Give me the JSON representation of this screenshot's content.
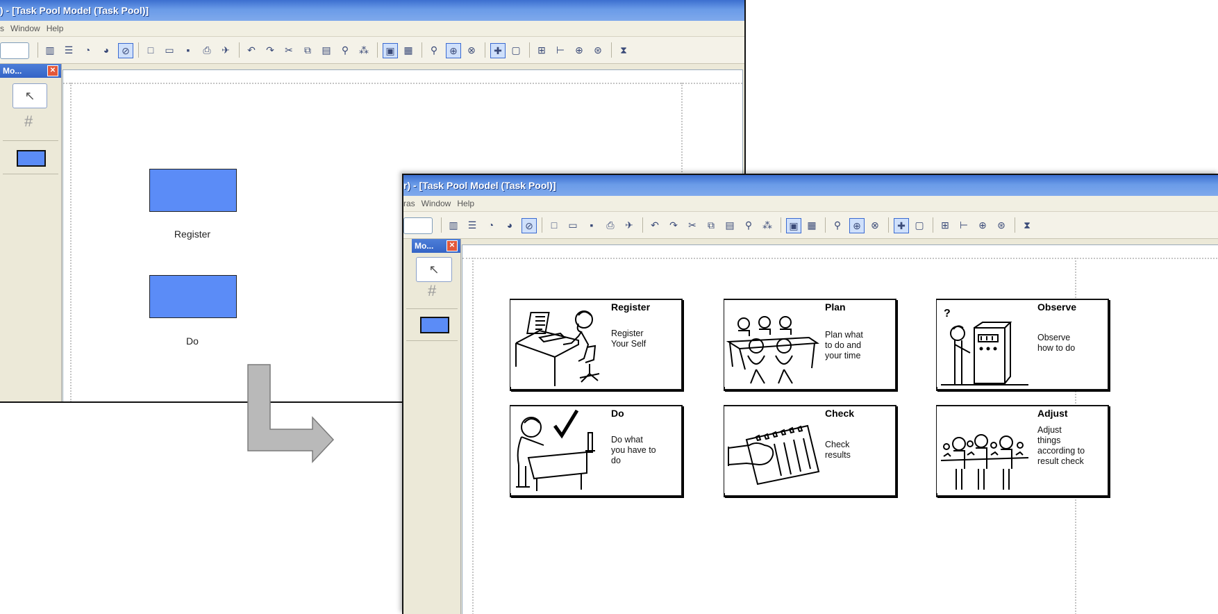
{
  "window1": {
    "title": ") - [Task Pool Model (Task Pool)]",
    "menu": [
      "s",
      "Window",
      "Help"
    ],
    "palette": {
      "header": "Mo...",
      "close": "✕"
    },
    "tasks": [
      {
        "label": "Register"
      },
      {
        "label": "Do"
      }
    ]
  },
  "window2": {
    "title": "r) - [Task Pool Model (Task Pool)]",
    "menu": [
      "ras",
      "Window",
      "Help"
    ],
    "palette": {
      "header": "Mo...",
      "close": "✕"
    },
    "cards": [
      {
        "title": "Register",
        "desc": "Register\nYour Self",
        "icon": "person-at-computer"
      },
      {
        "title": "Plan",
        "desc": "Plan what\nto do and\nyour time",
        "icon": "people-at-table"
      },
      {
        "title": "Observe",
        "desc": "Observe\nhow to do",
        "icon": "person-at-machine"
      },
      {
        "title": "Do",
        "desc": "Do what\nyou have to\ndo",
        "icon": "person-writing-checkmark"
      },
      {
        "title": "Check",
        "desc": "Check\nresults",
        "icon": "hand-with-checklist"
      },
      {
        "title": "Adjust",
        "desc": "Adjust\nthings\naccording to\nresult check",
        "icon": "people-adjusting"
      }
    ]
  },
  "colors": {
    "title_bar": "#3c6fcf",
    "task_fill": "#5b8cf7",
    "arrow": "#b9b9b9"
  }
}
